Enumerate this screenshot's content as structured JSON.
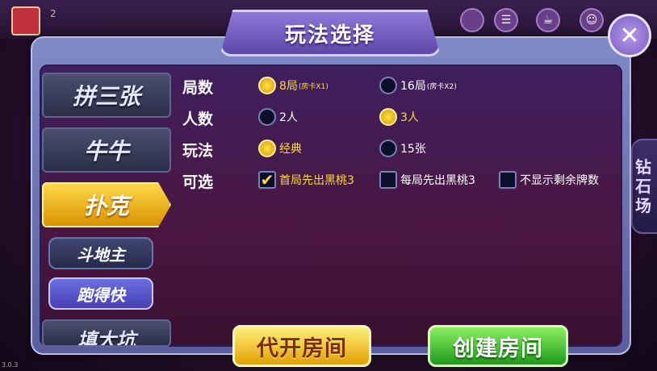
{
  "header": {
    "avatar_label": "",
    "name_text": "2"
  },
  "dialog": {
    "title": "玩法选择",
    "close_label": "✕"
  },
  "side_button": {
    "label_line1": "钻",
    "label_line2": "石",
    "label_line3": "场"
  },
  "tabs": [
    {
      "label": "拼三张",
      "active": false
    },
    {
      "label": "牛牛",
      "active": false
    },
    {
      "label": "扑克",
      "active": true
    }
  ],
  "subtabs": [
    {
      "label": "斗地主",
      "active": false
    },
    {
      "label": "跑得快",
      "active": true
    },
    {
      "label": "填大坑",
      "active": false
    }
  ],
  "rows": {
    "rounds": {
      "label": "局数",
      "options": [
        {
          "text": "8局",
          "sub": "(房卡X1)",
          "selected": true
        },
        {
          "text": "16局",
          "sub": "(房卡X2)",
          "selected": false
        }
      ]
    },
    "players": {
      "label": "人数",
      "options": [
        {
          "text": "2人",
          "selected": false
        },
        {
          "text": "3人",
          "selected": true
        }
      ]
    },
    "mode": {
      "label": "玩法",
      "options": [
        {
          "text": "经典",
          "selected": true
        },
        {
          "text": "15张",
          "selected": false
        }
      ]
    },
    "optional": {
      "label": "可选",
      "options": [
        {
          "text": "首局先出黑桃3",
          "checked": true
        },
        {
          "text": "每局先出黑桃3",
          "checked": false
        },
        {
          "text": "不显示剩余牌数",
          "checked": false
        }
      ]
    }
  },
  "buttons": {
    "proxy_open": "代开房间",
    "create_room": "创建房间"
  },
  "version": "3.0.3",
  "colors": {
    "selected_text": "#ffd83a",
    "accent_gold": "#e1a100",
    "accent_green": "#1d9a1b",
    "dialog_border": "#b7bde8"
  }
}
